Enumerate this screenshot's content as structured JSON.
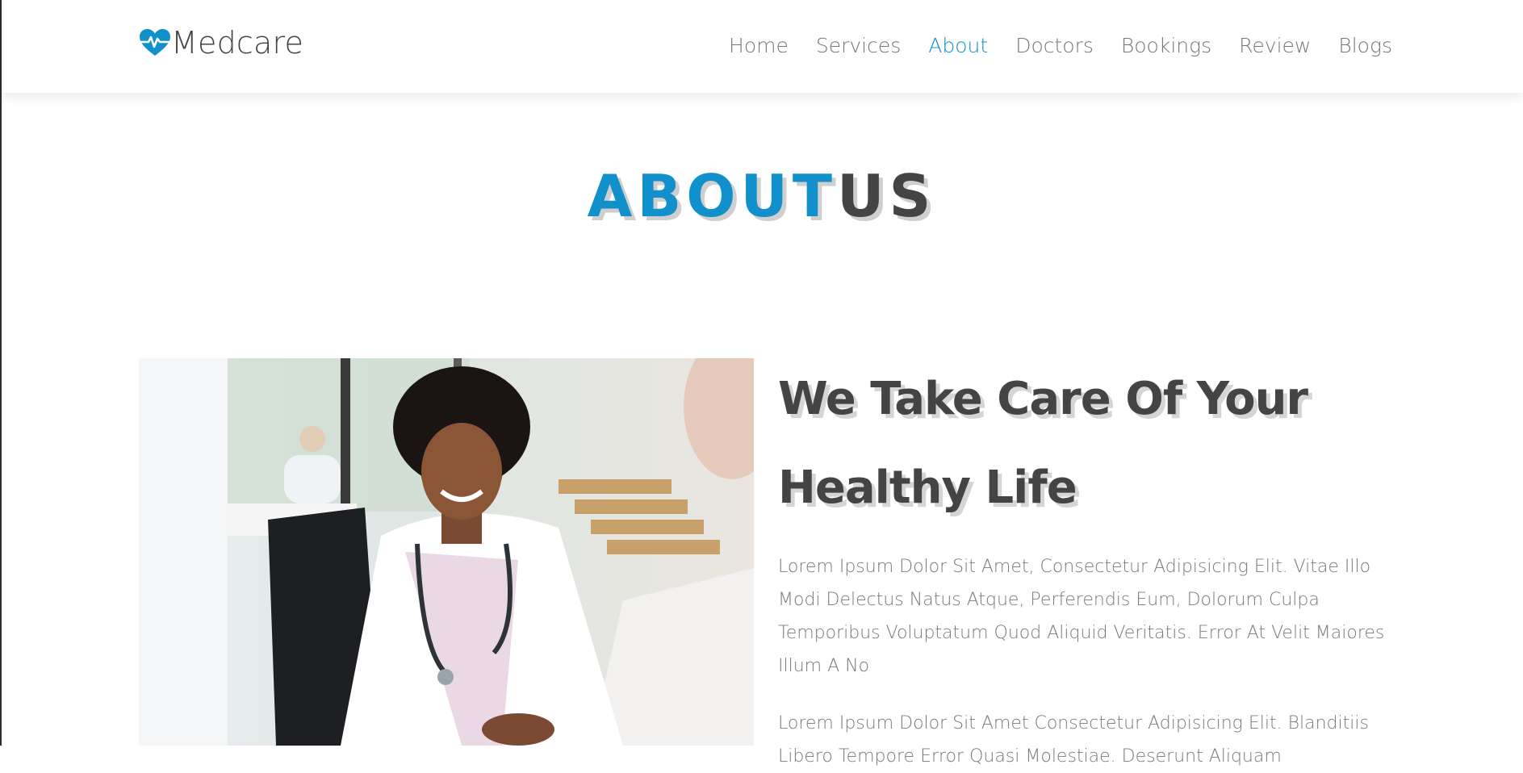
{
  "header": {
    "logo_text": "Medcare",
    "nav": [
      {
        "label": "Home",
        "active": false
      },
      {
        "label": "Services",
        "active": false
      },
      {
        "label": "About",
        "active": true
      },
      {
        "label": "Doctors",
        "active": false
      },
      {
        "label": "Bookings",
        "active": false
      },
      {
        "label": "Review",
        "active": false
      },
      {
        "label": "Blogs",
        "active": false
      }
    ]
  },
  "about": {
    "title_blue": "ABOUT",
    "title_dark": "US",
    "image_alt": "Smiling female doctor with stethoscope at desk",
    "heading_line1": "We Take Care Of Your",
    "heading_line2": "Healthy Life",
    "paragraph1": "Lorem Ipsum Dolor Sit Amet, Consectetur Adipisicing Elit. Vitae Illo Modi Delectus Natus Atque, Perferendis Eum, Dolorum Culpa Temporibus Voluptatum Quod Aliquid Veritatis. Error At Velit Maiores Illum A No",
    "paragraph2": "Lorem Ipsum Dolor Sit Amet Consectetur Adipisicing Elit. Blanditiis Libero Tempore Error Quasi Molestiae. Deserunt Aliquam"
  },
  "colors": {
    "accent": "#1190cc",
    "text_dark": "#444444",
    "text_muted": "#7a7a7a"
  }
}
